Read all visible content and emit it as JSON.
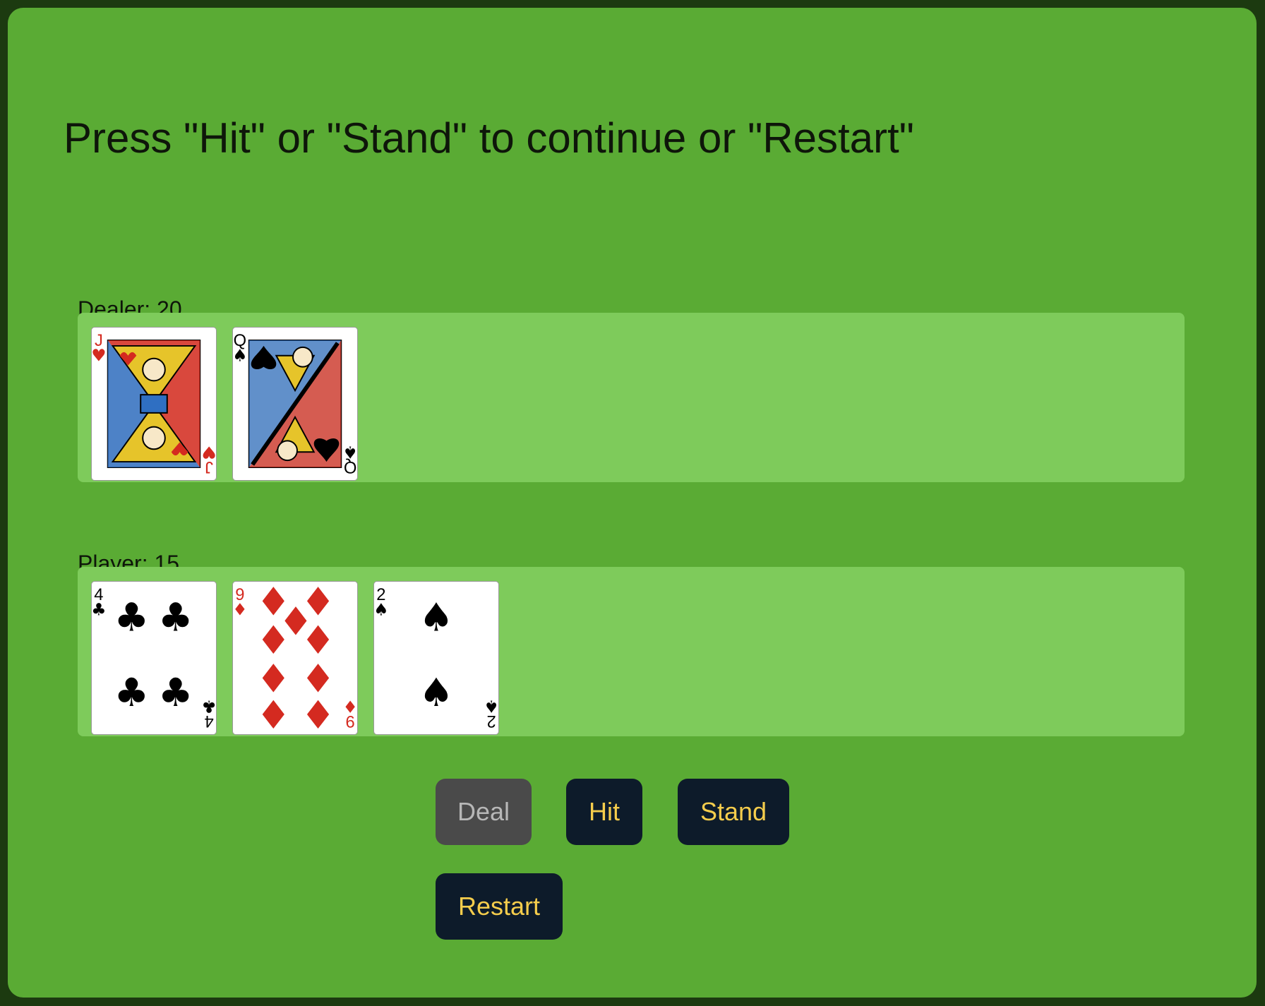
{
  "status_message": "Press \"Hit\" or \"Stand\" to continue or \"Restart\"",
  "dealer": {
    "label": "Dealer: 20",
    "cards": [
      {
        "rank": "J",
        "suit": "hearts",
        "symbol": "♥",
        "color": "#d42a20"
      },
      {
        "rank": "Q",
        "suit": "spades",
        "symbol": "♠",
        "color": "#000000"
      }
    ]
  },
  "player": {
    "label": "Player: 15",
    "cards": [
      {
        "rank": "4",
        "suit": "clubs",
        "symbol": "♣",
        "color": "#000000"
      },
      {
        "rank": "9",
        "suit": "diamonds",
        "symbol": "♦",
        "color": "#d42a20"
      },
      {
        "rank": "2",
        "suit": "spades",
        "symbol": "♠",
        "color": "#000000"
      }
    ]
  },
  "buttons": {
    "deal": {
      "label": "Deal",
      "disabled": true
    },
    "hit": {
      "label": "Hit"
    },
    "stand": {
      "label": "Stand"
    },
    "restart": {
      "label": "Restart"
    }
  },
  "colors": {
    "table": "#5aab34",
    "hand_area": "#7ecb5b",
    "border": "#1c3a10",
    "button_bg": "#0d1b2a",
    "button_text": "#f5cd4c",
    "button_disabled_bg": "#4a4a4a",
    "button_disabled_text": "#b7b7b7"
  }
}
